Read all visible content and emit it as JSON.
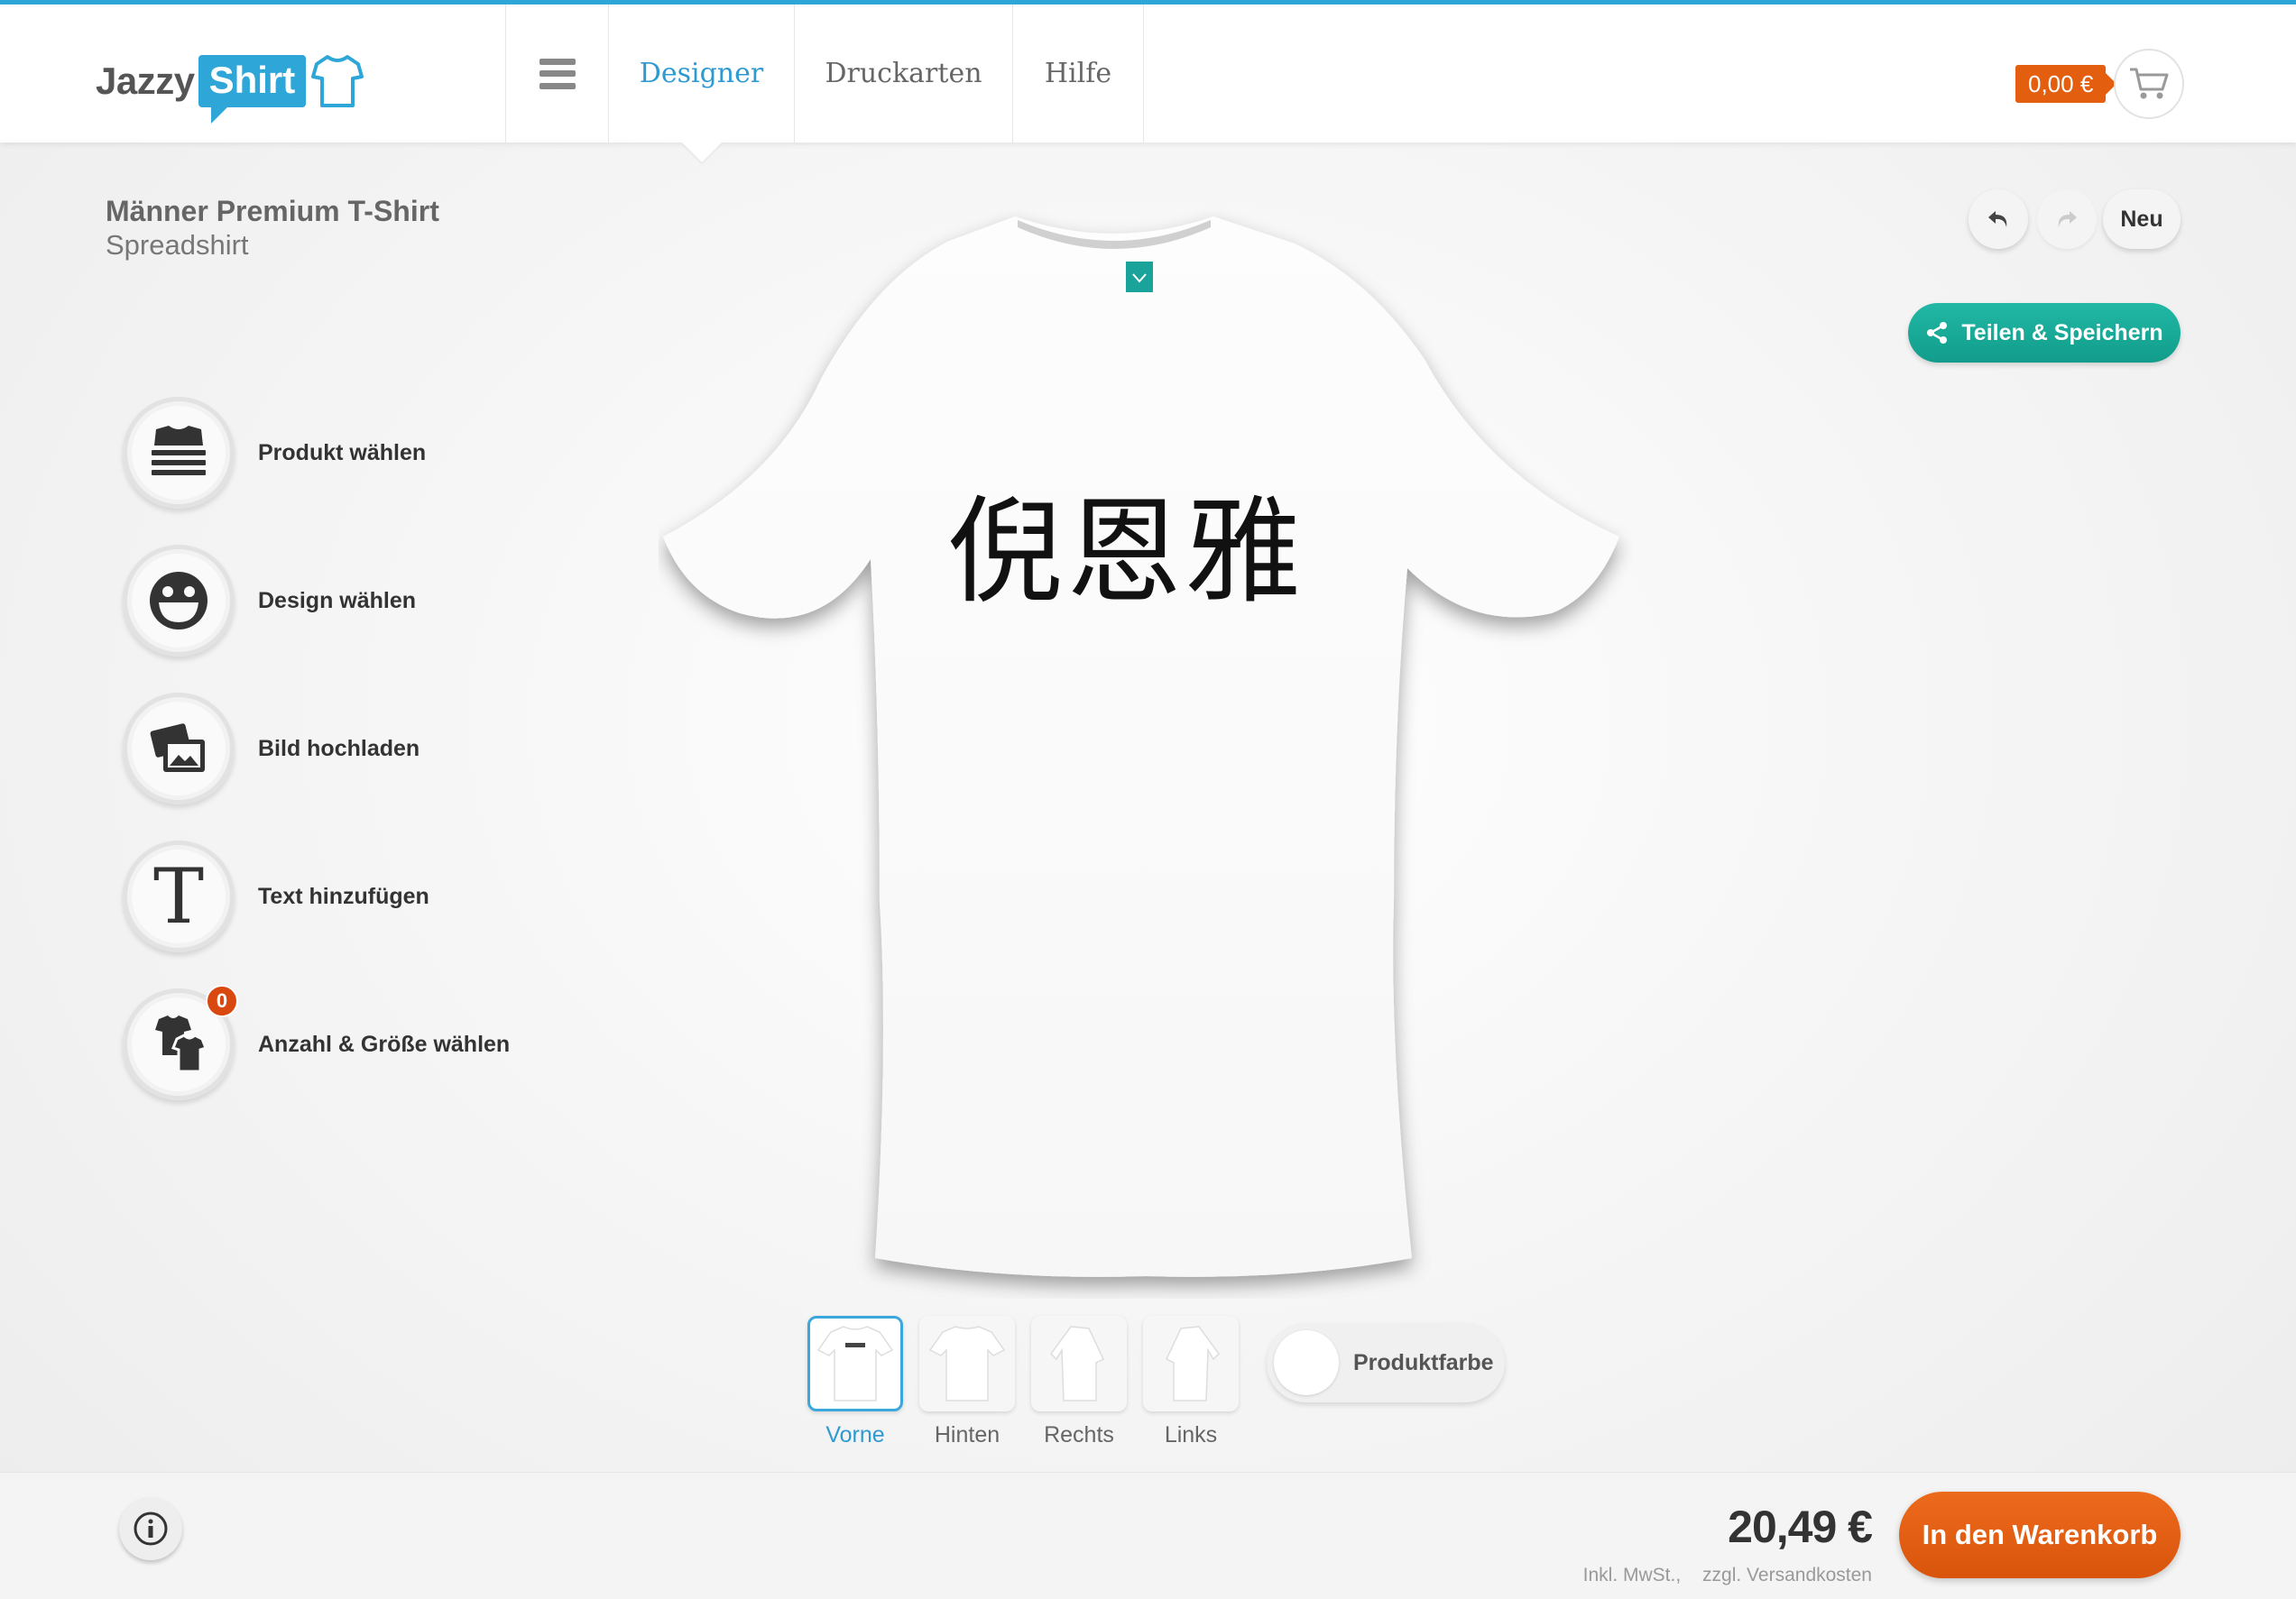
{
  "header": {
    "logo_word1": "Jazzy",
    "logo_word2": "Shirt",
    "nav": {
      "designer": "Designer",
      "druckarten": "Druckarten",
      "hilfe": "Hilfe"
    },
    "cart_total": "0,00 €"
  },
  "product": {
    "name": "Männer Premium T-Shirt",
    "brand": "Spreadshirt",
    "design_text": "倪恩雅",
    "color": "#ffffff"
  },
  "tools": [
    {
      "label": "Produkt wählen",
      "icon": "tshirt-stack-icon"
    },
    {
      "label": "Design wählen",
      "icon": "smiley-icon"
    },
    {
      "label": "Bild hochladen",
      "icon": "image-upload-icon"
    },
    {
      "label": "Text hinzufügen",
      "icon": "text-t-icon"
    },
    {
      "label": "Anzahl & Größe wählen",
      "icon": "shirts-size-icon",
      "badge": "0"
    }
  ],
  "controls": {
    "neu": "Neu",
    "share": "Teilen & Speichern"
  },
  "views": [
    {
      "label": "Vorne",
      "active": true
    },
    {
      "label": "Hinten",
      "active": false
    },
    {
      "label": "Rechts",
      "active": false
    },
    {
      "label": "Links",
      "active": false
    }
  ],
  "product_color_label": "Produktfarbe",
  "footer": {
    "price": "20,49 €",
    "tax_note": "Inkl. MwSt.,",
    "shipping_note": "zzgl. Versandkosten",
    "checkout": "In den Warenkorb"
  },
  "colors": {
    "accent": "#2ea6d8",
    "cart": "#e35f0f",
    "share": "#18ab98",
    "checkout": "#e05d12",
    "badge": "#d9480f"
  }
}
